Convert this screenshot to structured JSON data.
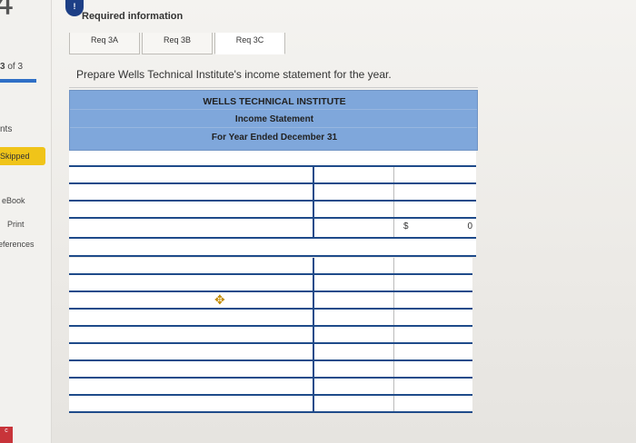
{
  "sidebar": {
    "question_number": "4",
    "part_current": "3",
    "part_total": "of 3",
    "points_label": "nts",
    "skipped_label": "Skipped",
    "ebook_label": "eBook",
    "print_label": "Print",
    "references_label": "eferences",
    "bottom_badge": "c"
  },
  "required_info": {
    "icon": "info-icon",
    "label": "Required information"
  },
  "tabs": [
    {
      "label": "Req 3A"
    },
    {
      "label": "Req 3B"
    },
    {
      "label": "Req 3C"
    }
  ],
  "instruction": "Prepare Wells Technical Institute's income statement for the year.",
  "statement": {
    "company": "WELLS TECHNICAL INSTITUTE",
    "title": "Income Statement",
    "period": "For Year Ended December 31"
  },
  "total_row": {
    "currency": "$",
    "value": "0"
  },
  "colors": {
    "header_blue": "#7fa7db",
    "grid_border": "#1f4b8a",
    "skipped_yellow": "#f0c419"
  }
}
